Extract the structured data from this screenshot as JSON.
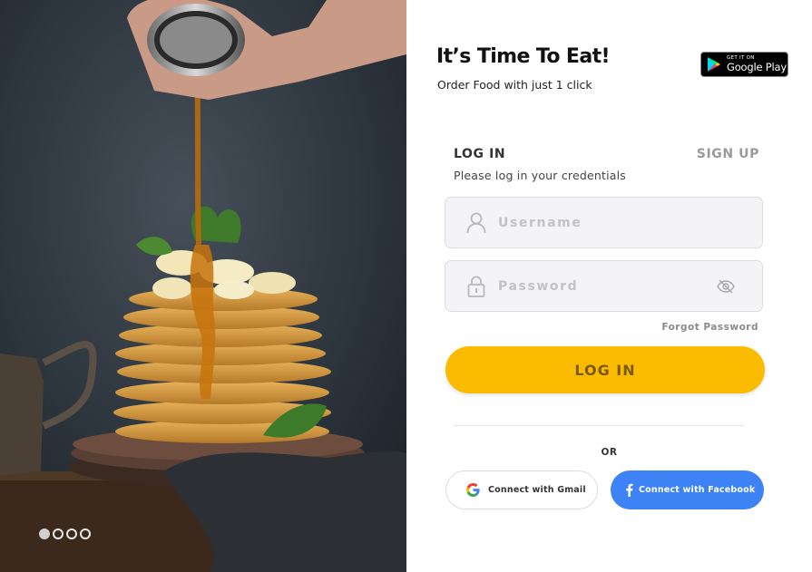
{
  "hero": {
    "carousel_count": 4,
    "active_index": 0
  },
  "header": {
    "title": "It’s Time To Eat!",
    "subtitle": "Order Food with just 1 click",
    "store_badge": {
      "top_text": "GET IT ON",
      "store_name": "Google Play",
      "icon": "google-play-icon"
    }
  },
  "auth": {
    "tabs": [
      {
        "label": "LOG IN",
        "active": true
      },
      {
        "label": "SIGN UP",
        "active": false
      }
    ],
    "hint": "Please log in your credentials",
    "username": {
      "placeholder": "Username",
      "value": "",
      "icon": "user-icon"
    },
    "password": {
      "placeholder": "Password",
      "value": "",
      "icon": "lock-icon",
      "toggle_icon": "eye-slash-icon"
    },
    "forgot_label": "Forgot Password",
    "submit_label": "LOG IN",
    "or_label": "OR",
    "social": {
      "gmail_label": "Connect with Gmail",
      "facebook_label": "Connect with Facebook"
    }
  },
  "colors": {
    "accent": "#fbbb00",
    "accent_text": "#7a5a00",
    "facebook": "#3d83f5",
    "field_bg": "#f4f4f6"
  }
}
